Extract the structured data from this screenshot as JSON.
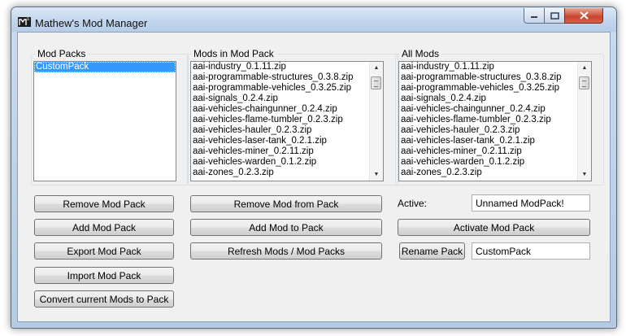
{
  "window": {
    "title": "Mathew's Mod Manager"
  },
  "groups": {
    "mod_packs": {
      "label": "Mod Packs",
      "items": [
        {
          "label": "CustomPack",
          "selected": true
        }
      ]
    },
    "mods_in_pack": {
      "label": "Mods in Mod Pack",
      "items": [
        "aai-industry_0.1.11.zip",
        "aai-programmable-structures_0.3.8.zip",
        "aai-programmable-vehicles_0.3.25.zip",
        "aai-signals_0.2.4.zip",
        "aai-vehicles-chaingunner_0.2.4.zip",
        "aai-vehicles-flame-tumbler_0.2.3.zip",
        "aai-vehicles-hauler_0.2.3.zip",
        "aai-vehicles-laser-tank_0.2.1.zip",
        "aai-vehicles-miner_0.2.11.zip",
        "aai-vehicles-warden_0.1.2.zip",
        "aai-zones_0.2.3.zip"
      ]
    },
    "all_mods": {
      "label": "All Mods",
      "items": [
        "aai-industry_0.1.11.zip",
        "aai-programmable-structures_0.3.8.zip",
        "aai-programmable-vehicles_0.3.25.zip",
        "aai-signals_0.2.4.zip",
        "aai-vehicles-chaingunner_0.2.4.zip",
        "aai-vehicles-flame-tumbler_0.2.3.zip",
        "aai-vehicles-hauler_0.2.3.zip",
        "aai-vehicles-laser-tank_0.2.1.zip",
        "aai-vehicles-miner_0.2.11.zip",
        "aai-vehicles-warden_0.1.2.zip",
        "aai-zones_0.2.3.zip"
      ]
    }
  },
  "buttons": {
    "remove_mod_pack": "Remove Mod Pack",
    "add_mod_pack": "Add Mod Pack",
    "export_mod_pack": "Export Mod Pack",
    "import_mod_pack": "Import Mod Pack",
    "convert_current": "Convert current Mods to Pack",
    "remove_mod_from_pack": "Remove Mod from Pack",
    "add_mod_to_pack": "Add Mod to Pack",
    "refresh": "Refresh Mods / Mod Packs",
    "activate_mod_pack": "Activate Mod Pack",
    "rename_pack": "Rename Pack"
  },
  "active": {
    "label": "Active:",
    "value": "Unnamed ModPack!"
  },
  "rename": {
    "value": "CustomPack"
  },
  "colors": {
    "selection": "#3399ff",
    "close_button": "#c8452b",
    "title_bar": "#c4d7ee"
  },
  "icons": {
    "app": "mod-manager-logo",
    "min": "minimize-icon",
    "max": "maximize-icon",
    "close": "close-icon"
  }
}
